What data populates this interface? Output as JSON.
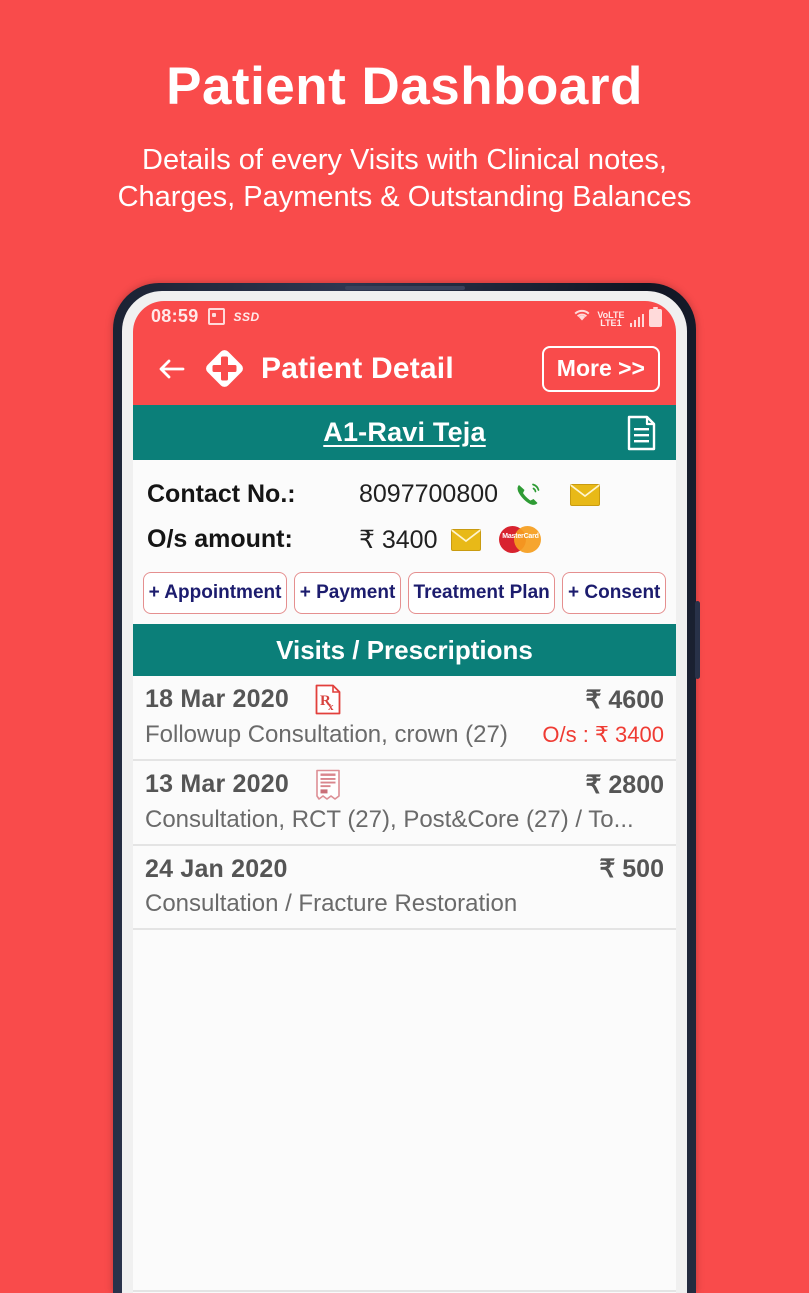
{
  "promo": {
    "title": "Patient Dashboard",
    "subtitle_line1": "Details of every Visits with Clinical notes,",
    "subtitle_line2": "Charges, Payments & Outstanding Balances"
  },
  "status_bar": {
    "time": "08:59",
    "screenshot_icon": "camera-icon",
    "ssd_label": "SSD",
    "wifi_icon": "wifi-icon",
    "volte_label_top": "VoLTE",
    "volte_label_bottom": "LTE1",
    "signal_icon": "signal-bars-icon",
    "battery_icon": "battery-icon"
  },
  "appbar": {
    "back_icon": "back-arrow-icon",
    "logo_icon": "medical-cross-diamond-icon",
    "title": "Patient Detail",
    "more_label": "More >>"
  },
  "patient": {
    "name": "A1-Ravi Teja",
    "notes_icon": "document-notes-icon"
  },
  "info": {
    "contact_label": "Contact No.:",
    "contact_value": "8097700800",
    "call_icon": "phone-call-icon",
    "sms_icon": "envelope-icon",
    "os_label": "O/s amount:",
    "os_value": "₹ 3400",
    "os_mail_icon": "envelope-icon",
    "card_icon": "mastercard-icon",
    "card_text": "MasterCard"
  },
  "actions": [
    {
      "label": "+ Appointment",
      "name": "add-appointment-button"
    },
    {
      "label": "+ Payment",
      "name": "add-payment-button"
    },
    {
      "label": "Treatment Plan",
      "name": "treatment-plan-button"
    },
    {
      "label": "+ Consent",
      "name": "add-consent-button"
    }
  ],
  "visits": {
    "section_title": "Visits / Prescriptions",
    "rows": [
      {
        "date": "18 Mar 2020",
        "icon": "rx-prescription-icon",
        "amount": "₹ 4600",
        "description": "Followup Consultation, crown (27)",
        "outstanding": "O/s : ₹ 3400"
      },
      {
        "date": "13 Mar 2020",
        "icon": "invoice-receipt-icon",
        "amount": "₹ 2800",
        "description": "Consultation, RCT (27), Post&Core (27) / To...",
        "outstanding": ""
      },
      {
        "date": "24 Jan 2020",
        "icon": "",
        "amount": "₹ 500",
        "description": "Consultation / Fracture Restoration",
        "outstanding": ""
      }
    ]
  },
  "colors": {
    "background_red": "#f94b4b",
    "teal": "#0b7f79",
    "button_border": "#e58f8f",
    "button_text": "#1c1c6e",
    "outstanding_red": "#ef3b33"
  }
}
